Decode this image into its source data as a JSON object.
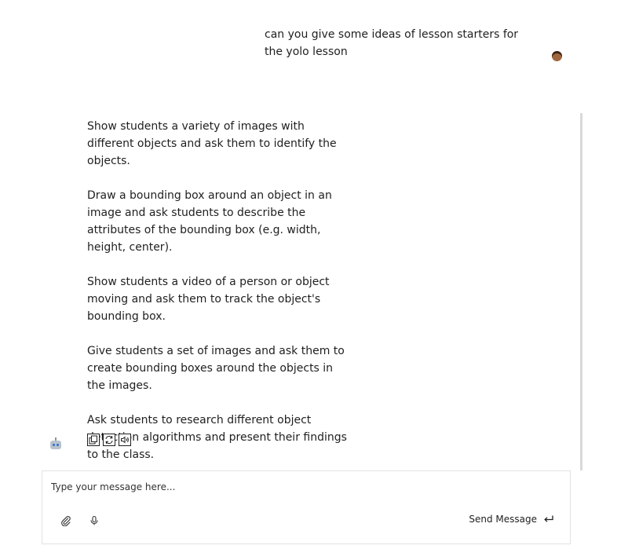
{
  "user_message": {
    "text": "can you give some ideas of lesson starters for the yolo lesson",
    "avatar_icon": "person-emoji-icon"
  },
  "assistant_message": {
    "paragraphs": [
      "Show students a variety of images with different objects and ask them to identify the objects.",
      "Draw a bounding box around an object in an image and ask students to describe the attributes of the bounding box (e.g. width, height, center).",
      "Show students a video of a person or object moving and ask them to track the object's bounding box.",
      "Give students a set of images and ask them to create bounding boxes around the objects in the images.",
      "Ask students to research different object detection algorithms and present their findings to the class."
    ],
    "avatar_icon": "robot-emoji-icon",
    "actions": [
      "copy-icon",
      "regenerate-icon",
      "read-aloud-icon"
    ]
  },
  "composer": {
    "placeholder": "Type your message here...",
    "value": "",
    "send_label": "Send Message",
    "attach_icon": "paperclip-icon",
    "mic_icon": "microphone-icon",
    "send_icon": "enter-return-icon"
  }
}
